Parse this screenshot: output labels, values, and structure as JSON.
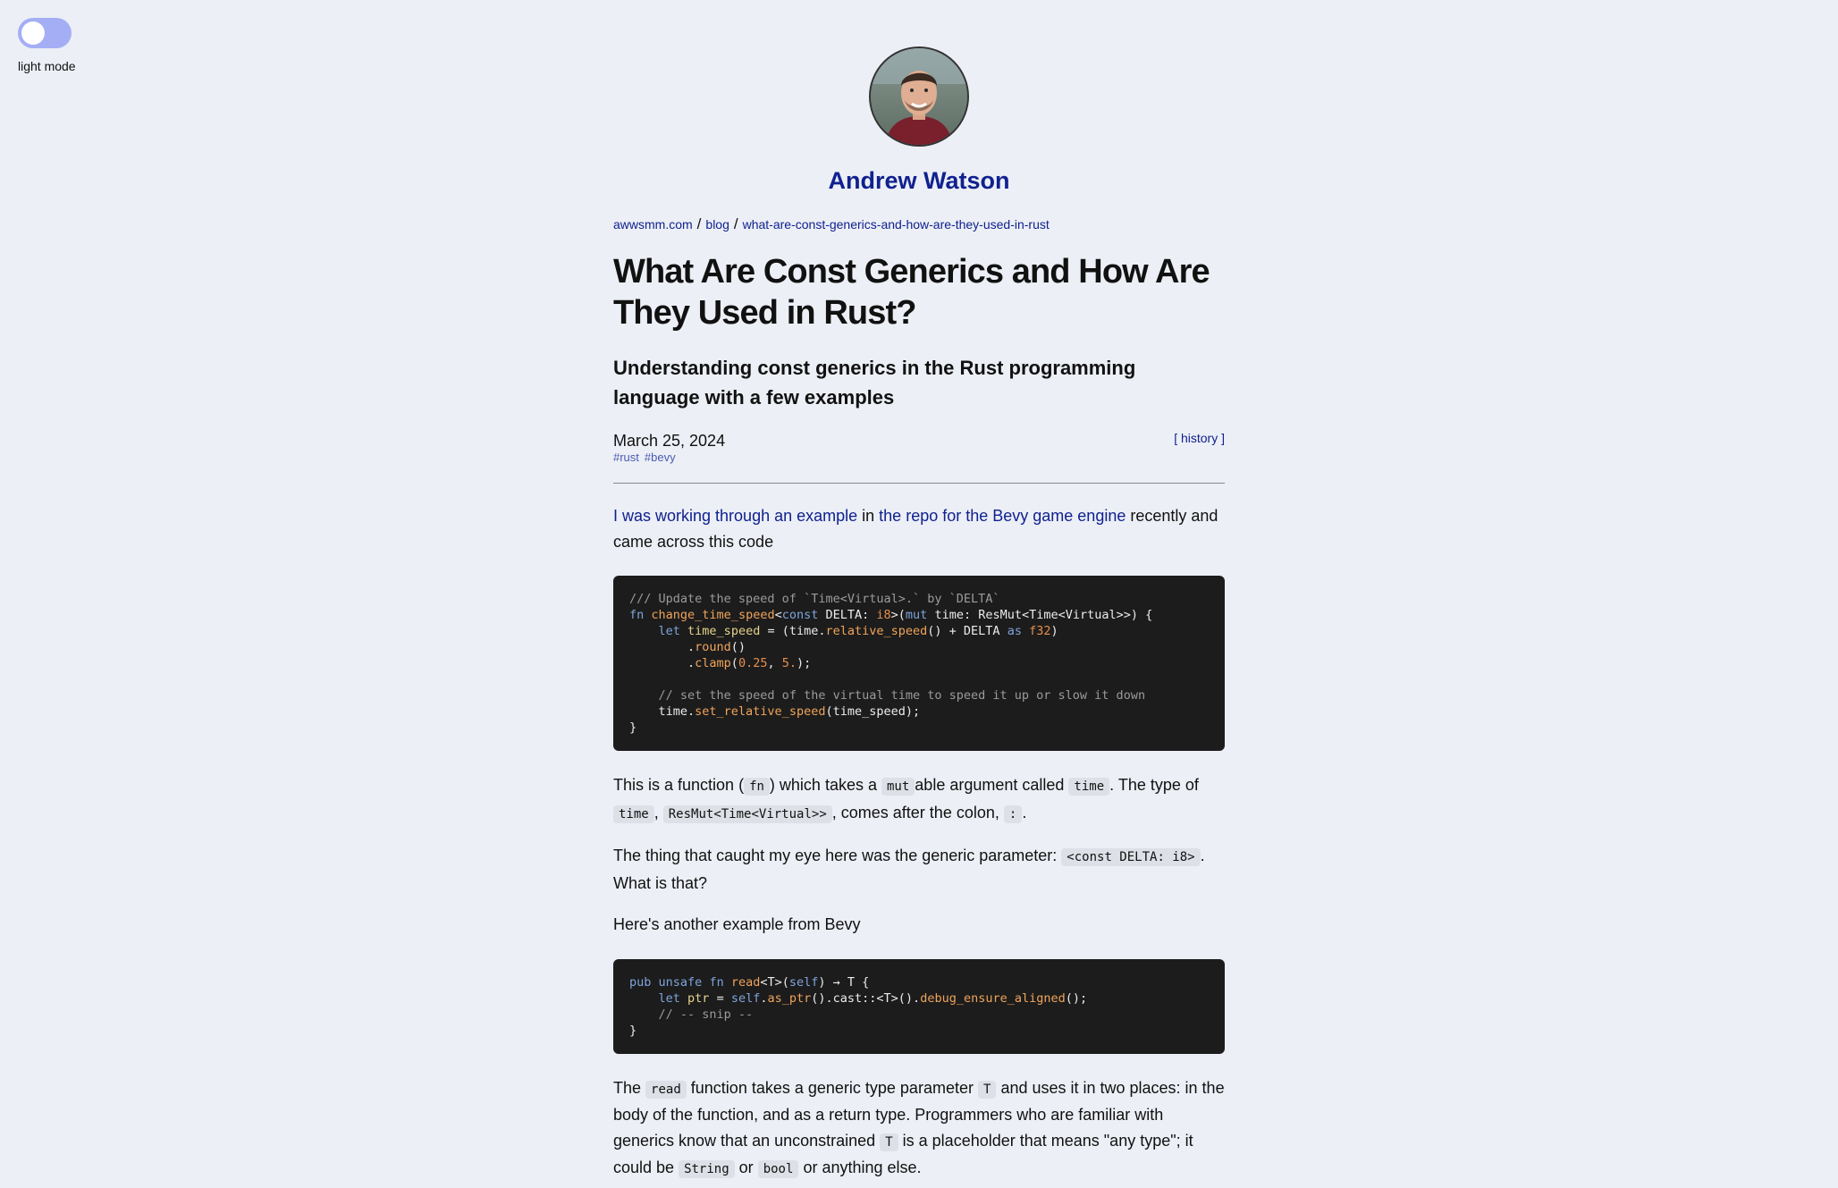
{
  "toggle": {
    "label": "light mode"
  },
  "author": {
    "name": "Andrew Watson"
  },
  "breadcrumb": {
    "items": [
      "awwsmm.com",
      "blog",
      "what-are-const-generics-and-how-are-they-used-in-rust"
    ],
    "separator": "/"
  },
  "article": {
    "title": "What Are Const Generics and How Are They Used in Rust?",
    "subtitle": "Understanding const generics in the Rust programming language with a few examples",
    "date": "March 25, 2024",
    "tags": [
      "#rust",
      "#bevy"
    ],
    "history_label": "[ history ]"
  },
  "p1": {
    "link1": "I was working through an example",
    "t1": " in ",
    "link2": "the repo for the Bevy game engine",
    "t2": " recently and came across this code"
  },
  "code1": {
    "l1": "/// Update the speed of `Time<Virtual>.` by `DELTA`",
    "l2_fn": "fn",
    "l2_name": "change_time_speed",
    "l2_a": "<",
    "l2_const": "const",
    "l2_b": " DELTA: ",
    "l2_i8": "i8",
    "l2_c": ">(",
    "l2_mut": "mut",
    "l2_d": " time: ResMut<Time<Virtual>>) {",
    "l3_let": "let",
    "l3_var": "time_speed",
    "l3_a": " = (time.",
    "l3_fn": "relative_speed",
    "l3_b": "() + DELTA ",
    "l3_as": "as",
    "l3_f32": "f32",
    "l3_c": ")",
    "l4_fn": "round",
    "l4_b": "()",
    "l5_fn": "clamp",
    "l5_n1": "0.25",
    "l5_n2": "5.",
    "l5_end": ");",
    "l7": "// set the speed of the virtual time to speed it up or slow it down",
    "l8_a": "time.",
    "l8_fn": "set_relative_speed",
    "l8_b": "(time_speed);",
    "l9": "}"
  },
  "p2": {
    "t1": "This is a function (",
    "c1": "fn",
    "t2": ") which takes a",
    "c2": "mut",
    "t3": "able argument called",
    "c3": "time",
    "t4": ". The type of",
    "c4": "time",
    "t5": ",",
    "c5": "ResMut<Time<Virtual>>",
    "t6": ", comes after the colon,",
    "c6": ":",
    "t7": "."
  },
  "p3": {
    "t1": "The thing that caught my eye here was the generic parameter:",
    "c1": "<const DELTA: i8>",
    "t2": ". What is that?"
  },
  "p4": {
    "t1": "Here's another example from Bevy"
  },
  "code2": {
    "l1_pub": "pub",
    "l1_unsafe": "unsafe",
    "l1_fn": "fn",
    "l1_name": "read",
    "l1_a": "<T>(",
    "l1_self": "self",
    "l1_b": ") → T {",
    "l2_let": "let",
    "l2_var": "ptr",
    "l2_a": " = ",
    "l2_self": "self",
    "l2_b": ".",
    "l2_fn1": "as_ptr",
    "l2_c": "().cast::<T>().",
    "l2_fn2": "debug_ensure_aligned",
    "l2_d": "();",
    "l3": "// -- snip --",
    "l4": "}"
  },
  "p5": {
    "t1": "The",
    "c1": "read",
    "t2": "function takes a generic type parameter",
    "c2": "T",
    "t3": "and uses it in two places: in the body of the function, and as a return type. Programmers who are familiar with generics know that an unconstrained",
    "c3": "T",
    "t4": "is a placeholder that means \"any type\"; it could be",
    "c4": "String",
    "t5": "or",
    "c5": "bool",
    "t6": "or anything else."
  }
}
